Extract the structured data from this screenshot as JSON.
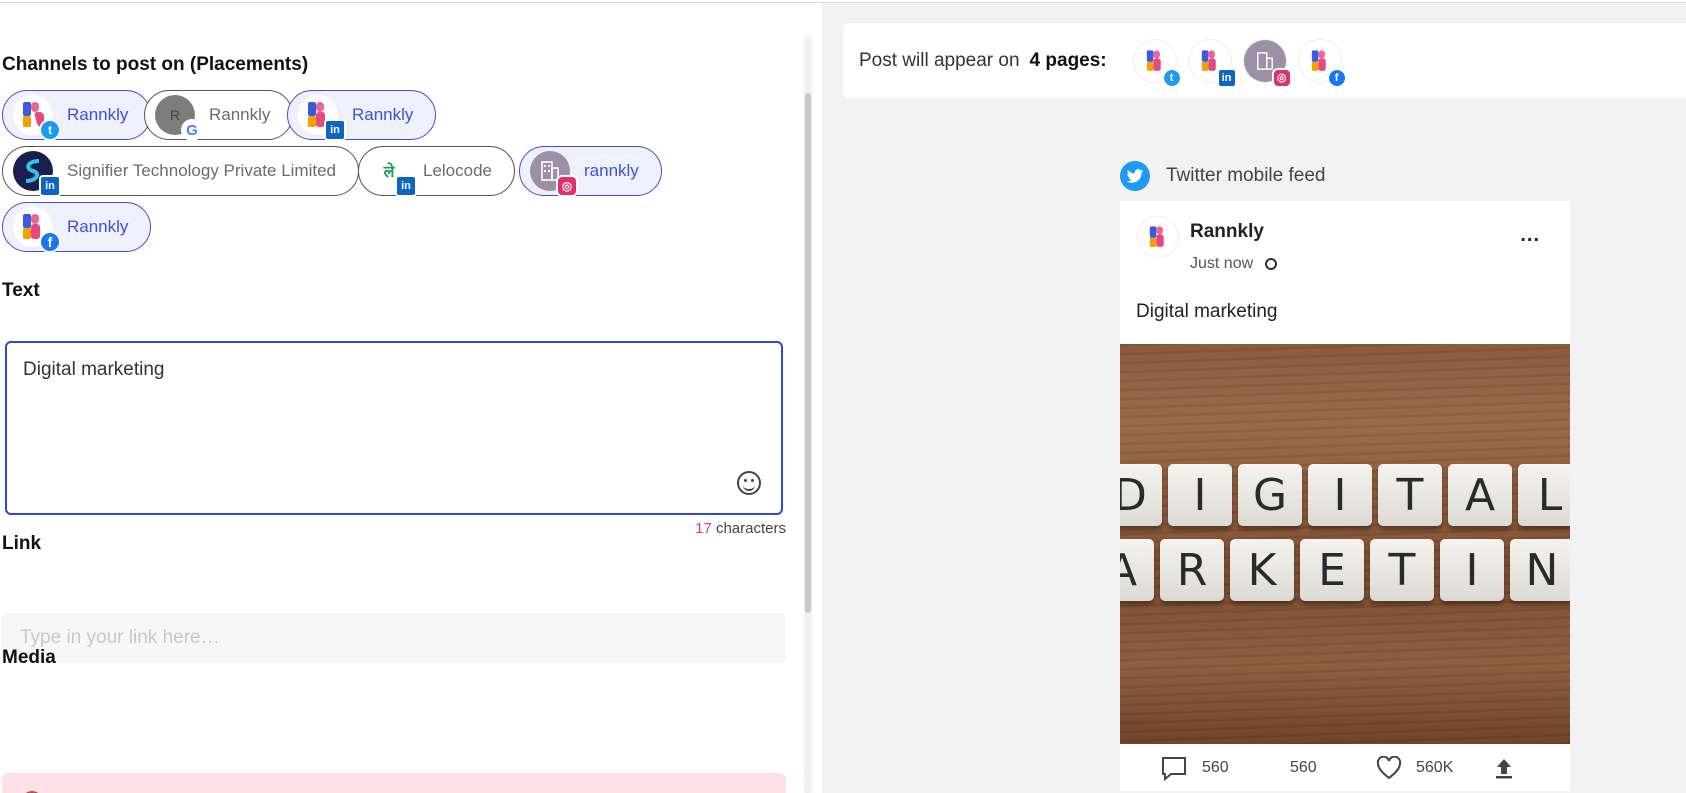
{
  "left": {
    "channels_title": "Channels to post on (Placements)",
    "channels": [
      {
        "label": "Rannkly",
        "network": "twitter",
        "selected": true
      },
      {
        "label": "Rannkly",
        "network": "google",
        "selected": false
      },
      {
        "label": "Rannkly",
        "network": "linkedin",
        "selected": true
      },
      {
        "label": "Signifier Technology Private Limited",
        "network": "linkedin",
        "selected": false
      },
      {
        "label": "Lelocode",
        "network": "linkedin",
        "selected": false
      },
      {
        "label": "rannkly",
        "network": "instagram",
        "selected": true
      },
      {
        "label": "Rannkly",
        "network": "facebook",
        "selected": true
      }
    ],
    "text_title": "Text",
    "text_value": "Digital marketing",
    "char_count": "17",
    "char_suffix": " characters",
    "link_title": "Link",
    "link_placeholder": "Type in your link here…",
    "media_title": "Media"
  },
  "right": {
    "appear_label": "Post will appear on",
    "appear_count": "4 pages:",
    "pages": [
      "twitter",
      "linkedin",
      "instagram",
      "facebook"
    ],
    "feed_title": "Twitter mobile feed",
    "post": {
      "name": "Rannkly",
      "time": "Just now",
      "text": "Digital marketing",
      "image_row1": [
        "D",
        "I",
        "G",
        "I",
        "T",
        "A",
        "L"
      ],
      "image_row2": [
        "A",
        "R",
        "K",
        "E",
        "T",
        "I",
        "N"
      ],
      "comments": "560",
      "retweets": "560",
      "likes": "560K"
    }
  },
  "colors": {
    "accent": "#3f51d8",
    "twitter": "#1d9bf0",
    "alert": "#e53950"
  }
}
